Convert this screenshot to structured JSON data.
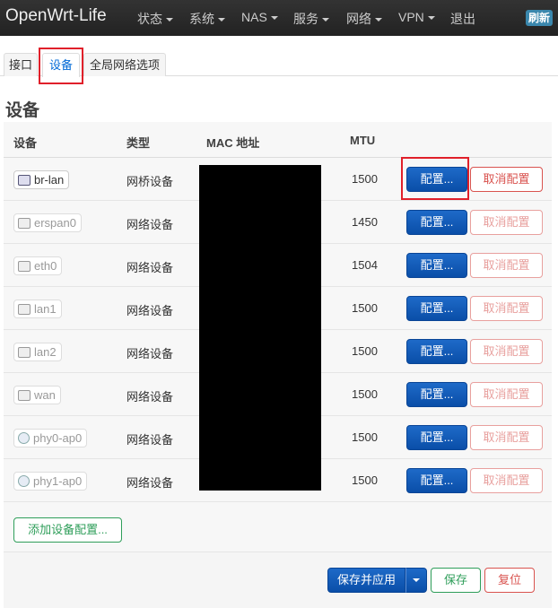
{
  "navbar": {
    "brand": "OpenWrt-Life",
    "menus": [
      "状态",
      "系统",
      "NAS",
      "服务",
      "网络",
      "VPN"
    ],
    "logout": "退出",
    "refresh": "刷新"
  },
  "tabs": [
    {
      "label": "接口"
    },
    {
      "label": "设备"
    },
    {
      "label": "全局网络选项"
    }
  ],
  "section_title": "设备",
  "table": {
    "headers": {
      "device": "设备",
      "type": "类型",
      "mac": "MAC 地址",
      "mtu": "MTU"
    },
    "rows": [
      {
        "device": "br-lan",
        "type": "网桥设备",
        "mtu": "1500",
        "icon": "bridge-icon"
      },
      {
        "device": "erspan0",
        "type": "网络设备",
        "mtu": "1450",
        "icon": "ethernet-port-icon"
      },
      {
        "device": "eth0",
        "type": "网络设备",
        "mtu": "1504",
        "icon": "ethernet-port-icon"
      },
      {
        "device": "lan1",
        "type": "网络设备",
        "mtu": "1500",
        "icon": "ethernet-port-icon"
      },
      {
        "device": "lan2",
        "type": "网络设备",
        "mtu": "1500",
        "icon": "ethernet-port-icon"
      },
      {
        "device": "wan",
        "type": "网络设备",
        "mtu": "1500",
        "icon": "ethernet-port-icon"
      },
      {
        "device": "phy0-ap0",
        "type": "网络设备",
        "mtu": "1500",
        "icon": "wifi-icon"
      },
      {
        "device": "phy1-ap0",
        "type": "网络设备",
        "mtu": "1500",
        "icon": "wifi-icon"
      }
    ],
    "configure_label": "配置...",
    "unconfigure_label": "取消配置"
  },
  "add_device_config": "添加设备配置...",
  "footer": {
    "save_apply": "保存并应用",
    "save": "保存",
    "reset": "复位"
  }
}
